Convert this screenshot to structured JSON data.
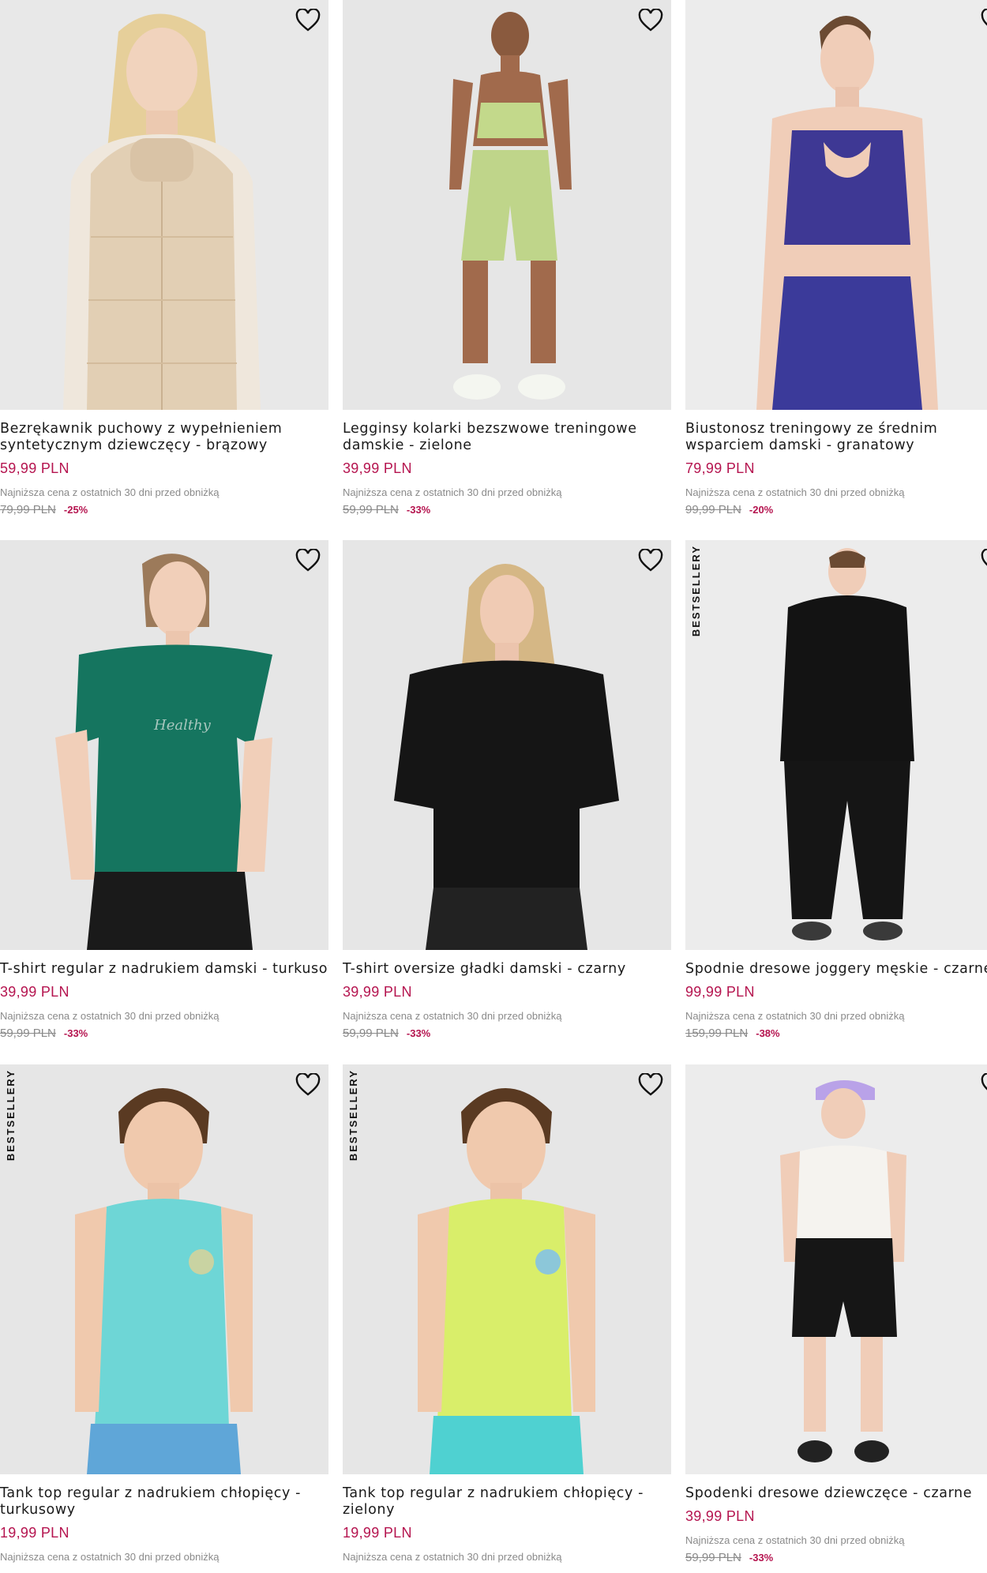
{
  "lowest_label": "Najniższa cena z ostatnich 30 dni przed obniżką",
  "badge_label": "BESTSELLERY",
  "products": [
    {
      "name": "Bezrękawnik puchowy z wypełnieniem syntetycznym dziewczęcy - brązowy",
      "price": "59,99 PLN",
      "old_price": "79,99 PLN",
      "discount": "-25%",
      "bestseller": false,
      "image": "girl-beige-puffer-vest"
    },
    {
      "name": "Legginsy kolarki bezszwowe treningowe damskie - zielone",
      "price": "39,99 PLN",
      "old_price": "59,99 PLN",
      "discount": "-33%",
      "bestseller": false,
      "image": "woman-green-bike-shorts"
    },
    {
      "name": "Biustonosz treningowy ze średnim wsparciem damski - granatowy",
      "price": "79,99 PLN",
      "old_price": "99,99 PLN",
      "discount": "-20%",
      "bestseller": false,
      "image": "woman-navy-sports-bra"
    },
    {
      "name": "T-shirt regular z nadrukiem damski - turkusowy",
      "price": "39,99 PLN",
      "old_price": "59,99 PLN",
      "discount": "-33%",
      "bestseller": false,
      "image": "woman-teal-tshirt"
    },
    {
      "name": "T-shirt oversize gładki damski - czarny",
      "price": "39,99 PLN",
      "old_price": "59,99 PLN",
      "discount": "-33%",
      "bestseller": false,
      "image": "woman-black-tshirt"
    },
    {
      "name": "Spodnie dresowe joggery męskie - czarne",
      "price": "99,99 PLN",
      "old_price": "159,99 PLN",
      "discount": "-38%",
      "bestseller": true,
      "image": "man-black-joggers"
    },
    {
      "name": "Tank top regular z nadrukiem chłopięcy - turkusowy",
      "price": "19,99 PLN",
      "old_price": "",
      "discount": "",
      "bestseller": true,
      "image": "boy-turquoise-tank"
    },
    {
      "name": "Tank top regular z nadrukiem chłopięcy - zielony",
      "price": "19,99 PLN",
      "old_price": "",
      "discount": "",
      "bestseller": true,
      "image": "boy-lime-tank"
    },
    {
      "name": "Spodenki dresowe dziewczęce - czarne",
      "price": "39,99 PLN",
      "old_price": "59,99 PLN",
      "discount": "-33%",
      "bestseller": false,
      "image": "girl-black-shorts"
    }
  ],
  "colors": {
    "price": "#b5144f",
    "muted": "#8a8a8a",
    "image_bg": "#e8e8e8"
  }
}
